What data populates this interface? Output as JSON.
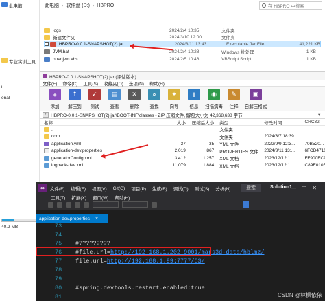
{
  "left_strip": {
    "items": [
      {
        "label": "此电脑",
        "icon": "computer-icon",
        "color": "#3a7bd5"
      },
      {
        "label": "专业实训工具",
        "icon": "folder-icon",
        "color": "#f3c84b"
      },
      {
        "label": "i",
        "icon": "drive-icon",
        "color": "#888888"
      },
      {
        "label": "enal",
        "icon": "drive-icon",
        "color": "#888888"
      },
      {
        "label": "40.2 MB",
        "icon": "disk-icon",
        "color": "#888888"
      }
    ],
    "drive_usage_fraction": 0.35
  },
  "explorer": {
    "breadcrumb": [
      "此电脑",
      "软件盘 (D:)",
      "HBPRO"
    ],
    "search_placeholder": "在 HBPRO 中搜索",
    "files": [
      {
        "name": "logs",
        "date": "2024/2/4 10:35",
        "type": "文件夹",
        "size": "",
        "icon": "folder",
        "selected": false
      },
      {
        "name": "新建文件夹",
        "date": "2024/3/10 12:00",
        "type": "文件夹",
        "size": "",
        "icon": "folder",
        "selected": false
      },
      {
        "name": "HBPRO-0.0.1-SNAPSHOT(2).jar",
        "date": "2024/3/11 13:43",
        "type": "Executable Jar File",
        "size": "41,221 KB",
        "icon": "jar",
        "selected": true
      },
      {
        "name": "JVM.bat",
        "date": "2024/2/4 10:28",
        "type": "Windows 批处理",
        "size": "1 KB",
        "icon": "bat",
        "selected": false
      },
      {
        "name": "openjvm.vbs",
        "date": "2024/2/5 10:46",
        "type": "VBScript Script ...",
        "size": "1 KB",
        "icon": "vbs",
        "selected": false
      }
    ]
  },
  "rar": {
    "title": "HBPRO-0.0.1-SNAPSHOT(2).jar (评估版本)",
    "menu": [
      "文件(F)",
      "命令(C)",
      "工具(S)",
      "收藏夹(O)",
      "选项(N)",
      "帮助(H)"
    ],
    "toolbar": [
      {
        "label": "添加",
        "icon": "add-icon",
        "color": "#8a4fbf"
      },
      {
        "label": "解压到",
        "icon": "extract-icon",
        "color": "#3b6fcf"
      },
      {
        "label": "测试",
        "icon": "test-icon",
        "color": "#b03a3a"
      },
      {
        "label": "查看",
        "icon": "view-icon",
        "color": "#4d8fd0"
      },
      {
        "label": "删除",
        "icon": "delete-icon",
        "color": "#5a5a5a"
      },
      {
        "label": "查找",
        "icon": "find-icon",
        "color": "#3a8fb3"
      },
      {
        "label": "向导",
        "icon": "wizard-icon",
        "color": "#d9b23a"
      },
      {
        "label": "信息",
        "icon": "info-icon",
        "color": "#2f7dc4"
      },
      {
        "label": "扫描病毒",
        "icon": "virus-scan-icon",
        "color": "#2f9a4a"
      },
      {
        "label": "注释",
        "icon": "comment-icon",
        "color": "#c98a30"
      },
      {
        "label": "自解压格式",
        "icon": "sfx-icon",
        "color": "#7b3f9a"
      }
    ],
    "path": "HBPRO-0.0.1-SNAPSHOT(2).jar\\BOOT-INF\\classes - ZIP 压缩文件, 解包大小为 42,368,638 字节",
    "columns": {
      "name": "名称",
      "size": "大小",
      "packed": "压缩后大小",
      "type": "类型",
      "modified": "修改时间",
      "crc": "CRC32"
    },
    "rows": [
      {
        "name": "..",
        "size": "",
        "packed": "",
        "type": "文件夹",
        "modified": "",
        "crc": "",
        "icon": "folder"
      },
      {
        "name": "com",
        "size": "",
        "packed": "",
        "type": "文件夹",
        "modified": "2024/3/7 18:39",
        "crc": "",
        "icon": "folder"
      },
      {
        "name": "application.yml",
        "size": "37",
        "packed": "35",
        "type": "YML 文件",
        "modified": "2022/9/9 12:3...",
        "crc": "70B520...",
        "icon": "yml"
      },
      {
        "name": "application-dev.properties",
        "size": "2,019",
        "packed": "867",
        "type": "PROPERTIES 文件",
        "modified": "2024/3/11 13:...",
        "crc": "6FCD4710",
        "icon": "java"
      },
      {
        "name": "generatorConfig.xml",
        "size": "3,412",
        "packed": "1,257",
        "type": "XML 文档",
        "modified": "2023/12/12 1...",
        "crc": "FF900EC9",
        "icon": "xml"
      },
      {
        "name": "logback-dev.xml",
        "size": "11,079",
        "packed": "1,884",
        "type": "XML 文档",
        "modified": "2023/12/12 1...",
        "crc": "C89E010B",
        "icon": "xml"
      }
    ]
  },
  "ide": {
    "menu_row1": [
      "文件(F)",
      "编辑(E)",
      "视图(V)",
      "Git(G)",
      "项目(P)",
      "生成(B)",
      "调试(D)",
      "测试(S)",
      "分析(N)"
    ],
    "menu_row2": [
      "工具(T)",
      "扩展(X)",
      "窗口(W)",
      "帮助(H)"
    ],
    "search_label": "搜索",
    "solution_name": "Solution1",
    "tab_label": "application-dev.properties",
    "tab_close": "×",
    "lines": [
      {
        "num": "73",
        "text": ""
      },
      {
        "num": "74",
        "text": ""
      },
      {
        "num": "75",
        "prefix": "#?????????",
        "link": ""
      },
      {
        "num": "76",
        "prefix": "#file.url=",
        "link": "http://192.168.1.202:9001/mars3d-data/hblmz/"
      },
      {
        "num": "77",
        "prefix": "file.url=",
        "link": "http://192.168.1.99:7777/CS/"
      },
      {
        "num": "78",
        "text": ""
      },
      {
        "num": "79",
        "text": ""
      },
      {
        "num": "80",
        "prefix": "#spring.devtools.restart.enabled:true",
        "link": ""
      },
      {
        "num": "81",
        "text": ""
      }
    ],
    "watermark": "CSDN @林枫依依"
  },
  "colors": {
    "selection": "#cce8ff",
    "ide_accent": "#007acc",
    "highlight_red": "#e02020",
    "link_blue": "#3794ff"
  }
}
